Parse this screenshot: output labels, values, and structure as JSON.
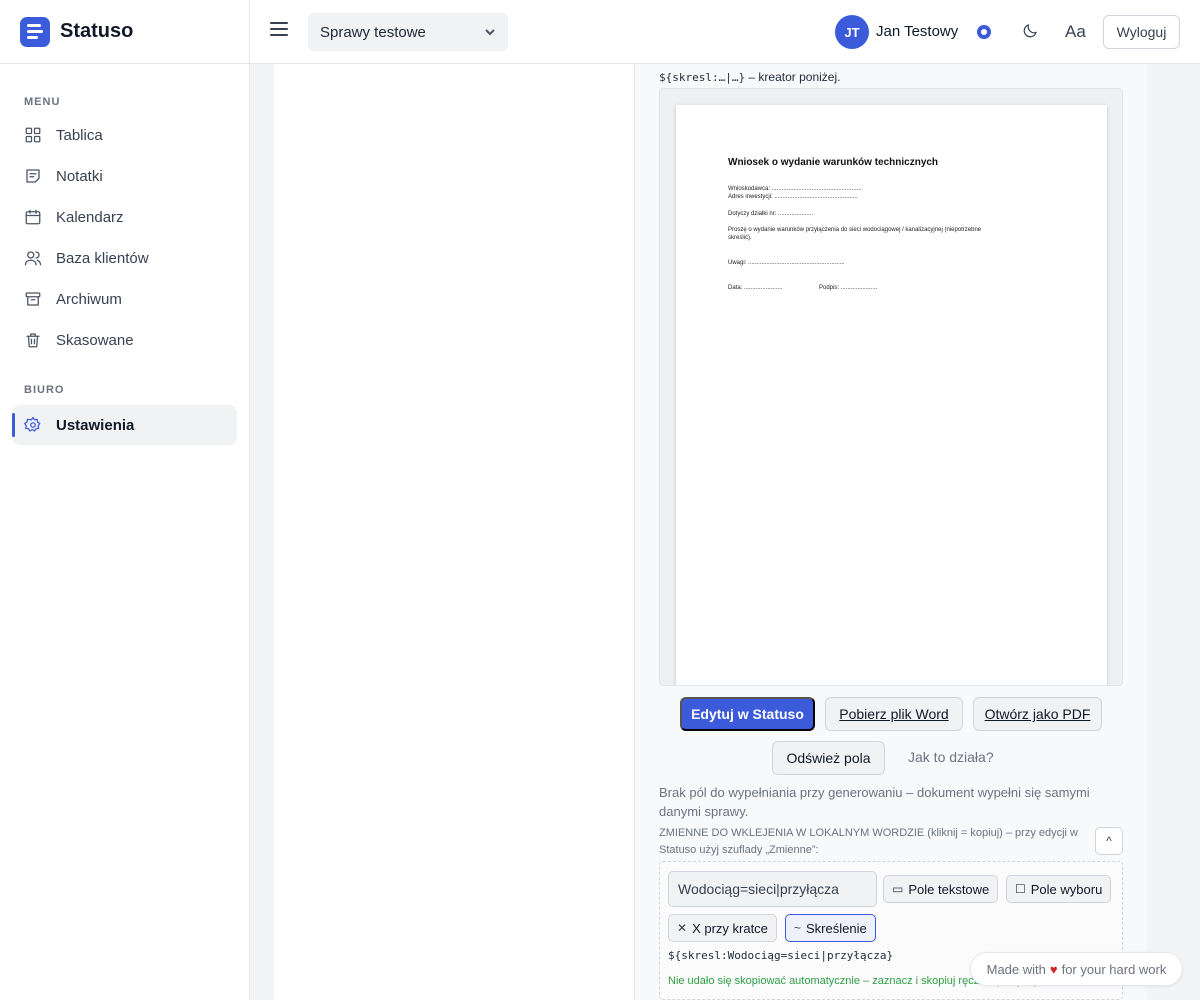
{
  "app": {
    "name": "Statuso"
  },
  "sidebar": {
    "section_menu": "MENU",
    "section_office": "BIURO",
    "items": [
      {
        "label": "Tablica",
        "icon": "grid-icon"
      },
      {
        "label": "Notatki",
        "icon": "note-icon"
      },
      {
        "label": "Kalendarz",
        "icon": "calendar-icon"
      },
      {
        "label": "Baza klientów",
        "icon": "users-icon"
      },
      {
        "label": "Archiwum",
        "icon": "archive-icon"
      },
      {
        "label": "Skasowane",
        "icon": "trash-icon"
      }
    ],
    "office_items": [
      {
        "label": "Ustawienia",
        "icon": "gear-icon",
        "active": true
      }
    ]
  },
  "topbar": {
    "case_select": "Sprawy testowe",
    "user_initials": "JT",
    "user_name": "Jan Testowy",
    "font_toggle": "Aa",
    "logout": "Wyloguj"
  },
  "editor": {
    "hint_code": "${skresl:…|…}",
    "hint_text": " – kreator poniżej.",
    "document": {
      "title": "Wniosek o wydanie warunków technicznych",
      "lines": {
        "applicant": "Wnioskodawca: ......................................................",
        "address": "Adres inwestycji: ..................................................",
        "plot": "Dotyczy działki nr: .....................",
        "request_1": "Proszę o wydanie warunków przyłączenia do sieci wodociągowej / kanalizacyjnej (niepotrzebne",
        "request_2": "skreślić).",
        "notes": "Uwagi: ..........................................................",
        "date": "Data: .......................",
        "signature": "Podpis: ......................"
      }
    },
    "buttons": {
      "edit": "Edytuj w Statuso",
      "download_word": "Pobierz plik Word",
      "open_pdf": "Otwórz jako PDF",
      "refresh": "Odśwież pola",
      "how_it_works": "Jak to działa?"
    },
    "info_text": "Brak pól do wypełniania przy generowaniu – dokument wypełni się samymi danymi sprawy.",
    "vars_text": "ZMIENNE DO WKLEJENIA W LOKALNYM WORDZIE (kliknij = kopiuj) – przy edycji w Statuso użyj szuflady „Zmienne”:",
    "collapse": "^",
    "var_input_value": "Wodociąg=sieci|przyłącza",
    "chips": {
      "text_field": "Pole tekstowe",
      "choice_field": "Pole wyboru",
      "checkbox_x": "X przy kratce",
      "strikethrough": "Skreślenie"
    },
    "code_output": "${skresl:Wodociąg=sieci|przyłącza}",
    "copy_error": "Nie udało się skopiować automatycznie – zaznacz i skopiuj ręcznie powyżej."
  },
  "footer": {
    "made_with_1": "Made with",
    "made_with_2": "for your hard work"
  }
}
